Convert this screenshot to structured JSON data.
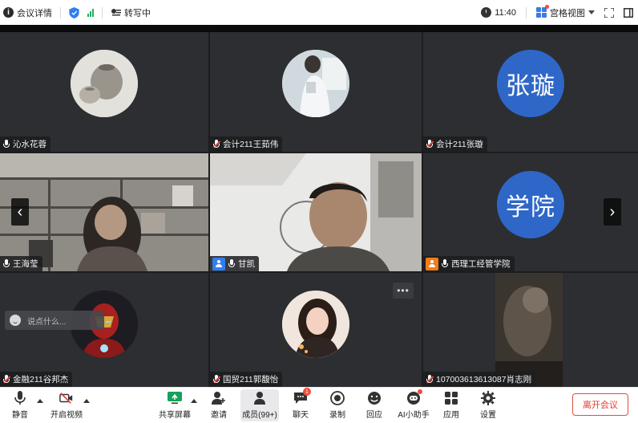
{
  "topbar": {
    "meeting_info": "会议详情",
    "transcribe": "转写中",
    "time": "11:40",
    "view_mode": "宫格视图"
  },
  "tiles": [
    {
      "name": "沁水花蓉",
      "avatar_type": "image",
      "mic": "on"
    },
    {
      "name": "会计211王茹伟",
      "avatar_type": "image",
      "mic": "muted"
    },
    {
      "name": "会计211张璇",
      "avatar_type": "text",
      "avatar_text": "张璇",
      "mic": "muted"
    },
    {
      "name": "王海莹",
      "avatar_type": "video",
      "mic": "on"
    },
    {
      "name": "甘凯",
      "avatar_type": "video",
      "mic": "on",
      "active_speaker": true
    },
    {
      "name": "西理工经管学院",
      "avatar_type": "text",
      "avatar_text": "学院",
      "mic": "on"
    },
    {
      "name": "金融211谷邦杰",
      "avatar_type": "image",
      "mic": "muted"
    },
    {
      "name": "国贸211郭馥怡",
      "avatar_type": "image",
      "mic": "muted"
    },
    {
      "name": "107003613613087肖志刚",
      "avatar_type": "video",
      "mic": "muted"
    }
  ],
  "chat_placeholder": "说点什么...",
  "toolbar": {
    "mute": "静音",
    "video": "开启视频",
    "share": "共享屏幕",
    "invite": "邀请",
    "members": "成员(99+)",
    "chat": "聊天",
    "chat_badge": "1",
    "record": "录制",
    "react": "回应",
    "ai": "AI小助手",
    "apps": "应用",
    "settings": "设置",
    "leave": "离开会议"
  },
  "colors": {
    "accent": "#2f67c8",
    "active_border": "#2ecb5a",
    "leave": "#e23b30"
  }
}
